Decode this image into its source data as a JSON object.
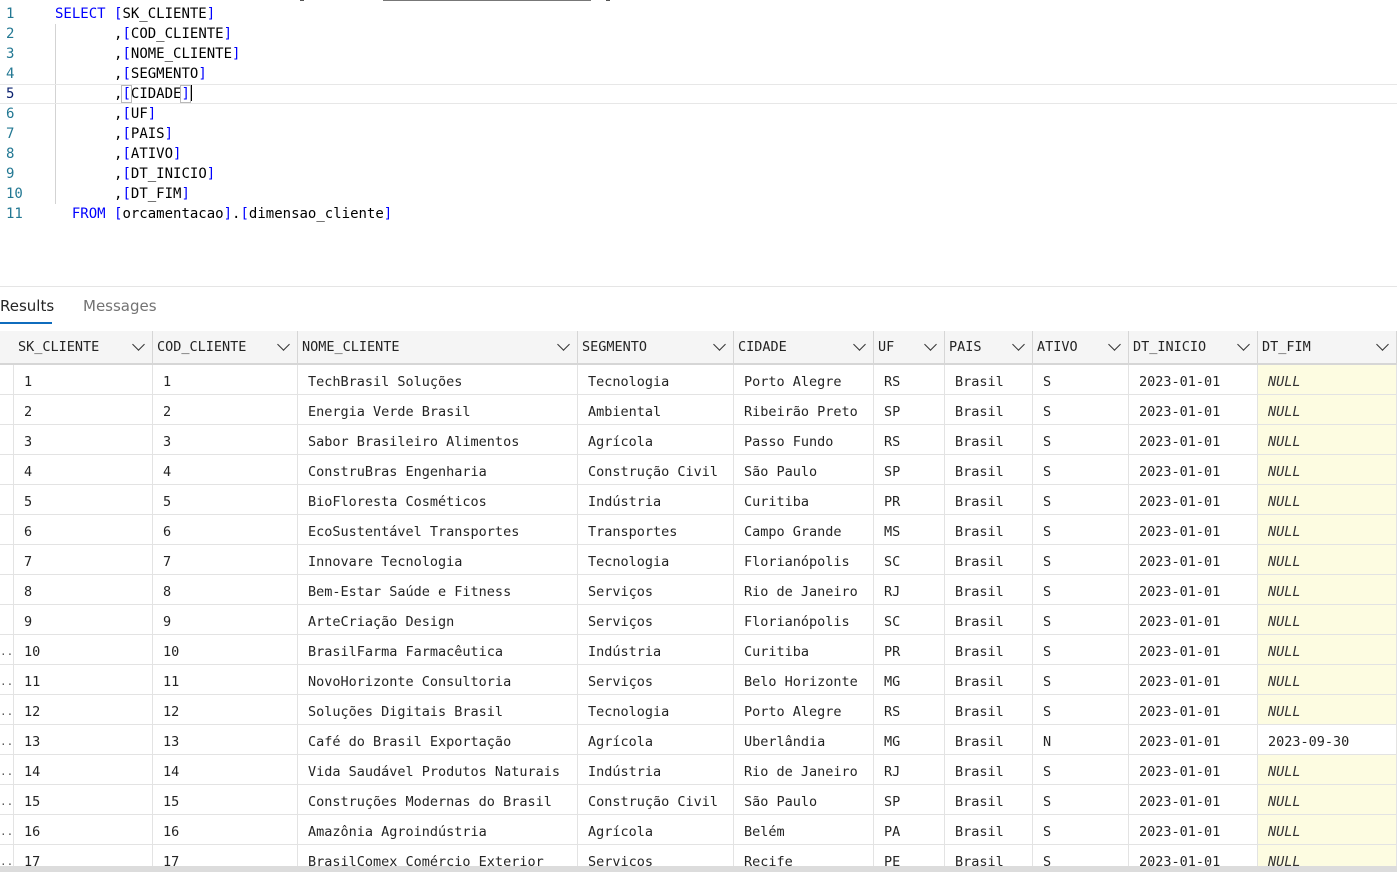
{
  "editor": {
    "lines": [
      {
        "n": "1",
        "parts": [
          [
            "kw",
            "SELECT "
          ],
          [
            "br",
            "["
          ],
          [
            "id",
            "SK_CLIENTE"
          ],
          [
            "br",
            "]"
          ]
        ]
      },
      {
        "n": "2",
        "parts": [
          [
            "sp",
            "       "
          ],
          [
            "punc",
            ","
          ],
          [
            "br",
            "["
          ],
          [
            "id",
            "COD_CLIENTE"
          ],
          [
            "br",
            "]"
          ]
        ]
      },
      {
        "n": "3",
        "parts": [
          [
            "sp",
            "       "
          ],
          [
            "punc",
            ","
          ],
          [
            "br",
            "["
          ],
          [
            "id",
            "NOME_CLIENTE"
          ],
          [
            "br",
            "]"
          ]
        ]
      },
      {
        "n": "4",
        "parts": [
          [
            "sp",
            "       "
          ],
          [
            "punc",
            ","
          ],
          [
            "br",
            "["
          ],
          [
            "id",
            "SEGMENTO"
          ],
          [
            "br",
            "]"
          ]
        ]
      },
      {
        "n": "5",
        "parts": [
          [
            "sp",
            "       "
          ],
          [
            "punc",
            ","
          ],
          [
            "bh",
            "["
          ],
          [
            "id",
            "CIDADE"
          ],
          [
            "bh",
            "]"
          ],
          [
            "caret",
            ""
          ]
        ]
      },
      {
        "n": "6",
        "parts": [
          [
            "sp",
            "       "
          ],
          [
            "punc",
            ","
          ],
          [
            "br",
            "["
          ],
          [
            "id",
            "UF"
          ],
          [
            "br",
            "]"
          ]
        ]
      },
      {
        "n": "7",
        "parts": [
          [
            "sp",
            "       "
          ],
          [
            "punc",
            ","
          ],
          [
            "br",
            "["
          ],
          [
            "id",
            "PAIS"
          ],
          [
            "br",
            "]"
          ]
        ]
      },
      {
        "n": "8",
        "parts": [
          [
            "sp",
            "       "
          ],
          [
            "punc",
            ","
          ],
          [
            "br",
            "["
          ],
          [
            "id",
            "ATIVO"
          ],
          [
            "br",
            "]"
          ]
        ]
      },
      {
        "n": "9",
        "parts": [
          [
            "sp",
            "       "
          ],
          [
            "punc",
            ","
          ],
          [
            "br",
            "["
          ],
          [
            "id",
            "DT_INICIO"
          ],
          [
            "br",
            "]"
          ]
        ]
      },
      {
        "n": "10",
        "parts": [
          [
            "sp",
            "       "
          ],
          [
            "punc",
            ","
          ],
          [
            "br",
            "["
          ],
          [
            "id",
            "DT_FIM"
          ],
          [
            "br",
            "]"
          ]
        ]
      },
      {
        "n": "11",
        "parts": [
          [
            "sp",
            "  "
          ],
          [
            "kw",
            "FROM "
          ],
          [
            "br",
            "["
          ],
          [
            "id",
            "orcamentacao"
          ],
          [
            "br",
            "]"
          ],
          [
            "punc",
            "."
          ],
          [
            "br",
            "["
          ],
          [
            "id",
            "dimensao_cliente"
          ],
          [
            "br",
            "]"
          ]
        ]
      }
    ],
    "current_line": 5
  },
  "results_tabs": {
    "results": "Results",
    "messages": "Messages",
    "active": "results"
  },
  "grid": {
    "columns": [
      "SK_CLIENTE",
      "COD_CLIENTE",
      "NOME_CLIENTE",
      "SEGMENTO",
      "CIDADE",
      "UF",
      "PAIS",
      "ATIVO",
      "DT_INICIO",
      "DT_FIM"
    ],
    "rows": [
      [
        "1",
        "1",
        "TechBrasil Soluções",
        "Tecnologia",
        "Porto Alegre",
        "RS",
        "Brasil",
        "S",
        "2023-01-01",
        "NULL"
      ],
      [
        "2",
        "2",
        "Energia Verde Brasil",
        "Ambiental",
        "Ribeirão Preto",
        "SP",
        "Brasil",
        "S",
        "2023-01-01",
        "NULL"
      ],
      [
        "3",
        "3",
        "Sabor Brasileiro Alimentos",
        "Agrícola",
        "Passo Fundo",
        "RS",
        "Brasil",
        "S",
        "2023-01-01",
        "NULL"
      ],
      [
        "4",
        "4",
        "ConstruBras Engenharia",
        "Construção Civil",
        "São Paulo",
        "SP",
        "Brasil",
        "S",
        "2023-01-01",
        "NULL"
      ],
      [
        "5",
        "5",
        "BioFloresta Cosméticos",
        "Indústria",
        "Curitiba",
        "PR",
        "Brasil",
        "S",
        "2023-01-01",
        "NULL"
      ],
      [
        "6",
        "6",
        "EcoSustentável Transportes",
        "Transportes",
        "Campo Grande",
        "MS",
        "Brasil",
        "S",
        "2023-01-01",
        "NULL"
      ],
      [
        "7",
        "7",
        "Innovare Tecnologia",
        "Tecnologia",
        "Florianópolis",
        "SC",
        "Brasil",
        "S",
        "2023-01-01",
        "NULL"
      ],
      [
        "8",
        "8",
        "Bem-Estar Saúde e Fitness",
        "Serviços",
        "Rio de Janeiro",
        "RJ",
        "Brasil",
        "S",
        "2023-01-01",
        "NULL"
      ],
      [
        "9",
        "9",
        "ArteCriação Design",
        "Serviços",
        "Florianópolis",
        "SC",
        "Brasil",
        "S",
        "2023-01-01",
        "NULL"
      ],
      [
        "10",
        "10",
        "BrasilFarma Farmacêutica",
        "Indústria",
        "Curitiba",
        "PR",
        "Brasil",
        "S",
        "2023-01-01",
        "NULL"
      ],
      [
        "11",
        "11",
        "NovoHorizonte Consultoria",
        "Serviços",
        "Belo Horizonte",
        "MG",
        "Brasil",
        "S",
        "2023-01-01",
        "NULL"
      ],
      [
        "12",
        "12",
        "Soluções Digitais Brasil",
        "Tecnologia",
        "Porto Alegre",
        "RS",
        "Brasil",
        "S",
        "2023-01-01",
        "NULL"
      ],
      [
        "13",
        "13",
        "Café do Brasil Exportação",
        "Agrícola",
        "Uberlândia",
        "MG",
        "Brasil",
        "N",
        "2023-01-01",
        "2023-09-30"
      ],
      [
        "14",
        "14",
        "Vida Saudável Produtos Naturais",
        "Indústria",
        "Rio de Janeiro",
        "RJ",
        "Brasil",
        "S",
        "2023-01-01",
        "NULL"
      ],
      [
        "15",
        "15",
        "Construções Modernas do Brasil",
        "Construção Civil",
        "São Paulo",
        "SP",
        "Brasil",
        "S",
        "2023-01-01",
        "NULL"
      ],
      [
        "16",
        "16",
        "Amazônia Agroindústria",
        "Agrícola",
        "Belém",
        "PA",
        "Brasil",
        "S",
        "2023-01-01",
        "NULL"
      ],
      [
        "17",
        "17",
        "BrasilComex Comércio Exterior",
        "Serviços",
        "Recife",
        "PE",
        "Brasil",
        "S",
        "2023-01-01",
        "NULL"
      ]
    ],
    "row_gutter_marker": ".."
  }
}
